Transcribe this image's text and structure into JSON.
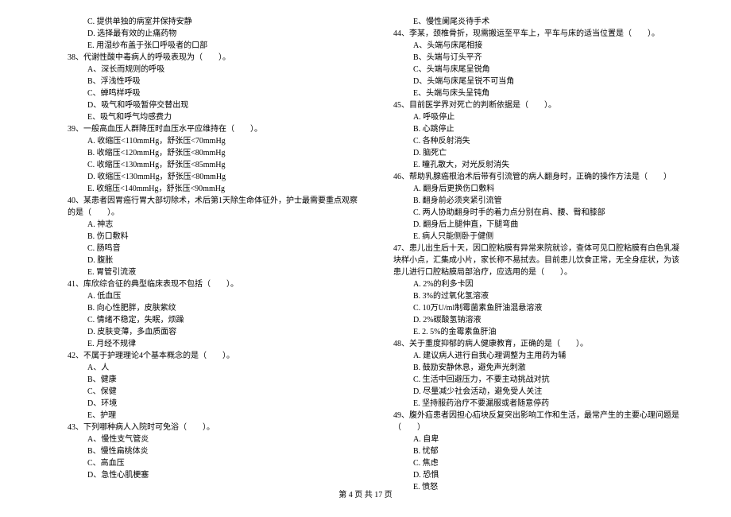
{
  "left": {
    "pre_opts": [
      "C. 提供单独的病室并保持安静",
      "D. 选择最有效的止痛药物",
      "E. 用湿纱布盖于张口呼吸者的口部"
    ],
    "q38": {
      "stem": "38、代谢性酸中毒病人的呼吸表现为（　　）。",
      "opts": [
        "A、深长而规则的呼吸",
        "B、浮浅性呼吸",
        "C、蝉鸣样呼吸",
        "D、吸气和呼吸暂停交替出现",
        "E、吸气和呼气均感费力"
      ]
    },
    "q39": {
      "stem": "39、一般高血压人群降压时血压水平应维持在（　　）。",
      "opts": [
        "A. 收缩压<110mmHg，舒张压<70mmHg",
        "B. 收缩压<120mmHg，舒张压<80mmHg",
        "C. 收缩压<130mmHg，舒张压<85mmHg",
        "D. 收缩压<130mmHg，舒张压<80mmHg",
        "E. 收缩压<140mmHg，舒张压<90mmHg"
      ]
    },
    "q40": {
      "stem": "40、某患者因胃癌行胃大部切除术，术后第1天除生命体征外，护士最需要重点观察的是（　　）。",
      "opts": [
        "A. 神志",
        "B. 伤口敷料",
        "C. 肠鸣音",
        "D. 腹胀",
        "E. 胃管引流液"
      ]
    },
    "q41": {
      "stem": "41、库欣综合征的典型临床表现不包括（　　）。",
      "opts": [
        "A. 低血压",
        "B. 向心性肥胖，皮肤紫纹",
        "C. 情绪不稳定，失眠，烦躁",
        "D. 皮肤变薄，多血质面容",
        "E. 月经不规律"
      ]
    },
    "q42": {
      "stem": "42、不属于护理理论4个基本概念的是（　　）。",
      "opts": [
        "A、人",
        "B、健康",
        "C、保健",
        "D、环境",
        "E、护理"
      ]
    },
    "q43": {
      "stem": "43、下列哪种病人入院时可免浴（　　）。",
      "opts": [
        "A、慢性支气管炎",
        "B、慢性扁桃体炎",
        "C、高血压",
        "D、急性心肌梗塞"
      ]
    }
  },
  "right": {
    "pre_opts": [
      "E、慢性阑尾炎待手术"
    ],
    "q44": {
      "stem": "44、李某，颈椎骨折，现需搬运至平车上，平车与床的适当位置是（　　）。",
      "opts": [
        "A、头端与床尾相接",
        "B、头端与订头平齐",
        "C、头端与床尾呈锐角",
        "D、头端与床尾呈锐不可当角",
        "E、头端与床头呈钝角"
      ]
    },
    "q45": {
      "stem": "45、目前医学界对死亡的判断依据是（　　）。",
      "opts": [
        "A. 呼吸停止",
        "B. 心跳停止",
        "C. 各种反射消失",
        "D. 脑死亡",
        "E. 瞳孔散大，对光反射消失"
      ]
    },
    "q46": {
      "stem": "46、帮助乳腺癌根治术后带有引流管的病人翻身时，正确的操作方法是（　　）",
      "opts": [
        "A. 翻身后更换伤口敷料",
        "B. 翻身前必须夹紧引流管",
        "C. 两人协助翻身时手的着力点分别在肩、腰、臀和膝部",
        "D. 翻身后上腿伸直，下腿弯曲",
        "E. 病人只能侧卧于健侧"
      ]
    },
    "q47": {
      "stem": "47、患儿出生后十天，因口腔粘膜有异常来院就诊，查体可见口腔粘膜有白色乳凝块样小点，汇集成小片，家长称不易拭去。目前患儿饮食正常，无全身症状，为该患儿进行口腔粘膜局部治疗，应选用的是（　　）。",
      "opts": [
        "A. 2%的利多卡因",
        "B. 3%的过氧化氢溶液",
        "C. 10万U/ml制霉菌素鱼肝油混悬溶液",
        "D. 2%碳酸氢钠溶液",
        "E. 2. 5%的金霉素鱼肝油"
      ]
    },
    "q48": {
      "stem": "48、关于重度抑郁的病人健康教育，正确的是（　　）。",
      "opts": [
        "A. 建议病人进行自我心理调整为主用药为辅",
        "B. 鼓励安静休息，避免声光刺激",
        "C. 生活中回避压力，不要主动挑战对抗",
        "D. 尽量减少社会活动，避免受人关注",
        "E. 坚持服药治疗不要漏服或者随意停药"
      ]
    },
    "q49": {
      "stem": "49、腹外疝患者因担心疝块反复突出影响工作和生活，最常产生的主要心理问题是（　　）",
      "opts": [
        "A. 自卑",
        "B. 忧郁",
        "C. 焦虑",
        "D. 恐惧",
        "E. 愤怒"
      ]
    }
  },
  "footer": "第 4 页 共 17 页"
}
